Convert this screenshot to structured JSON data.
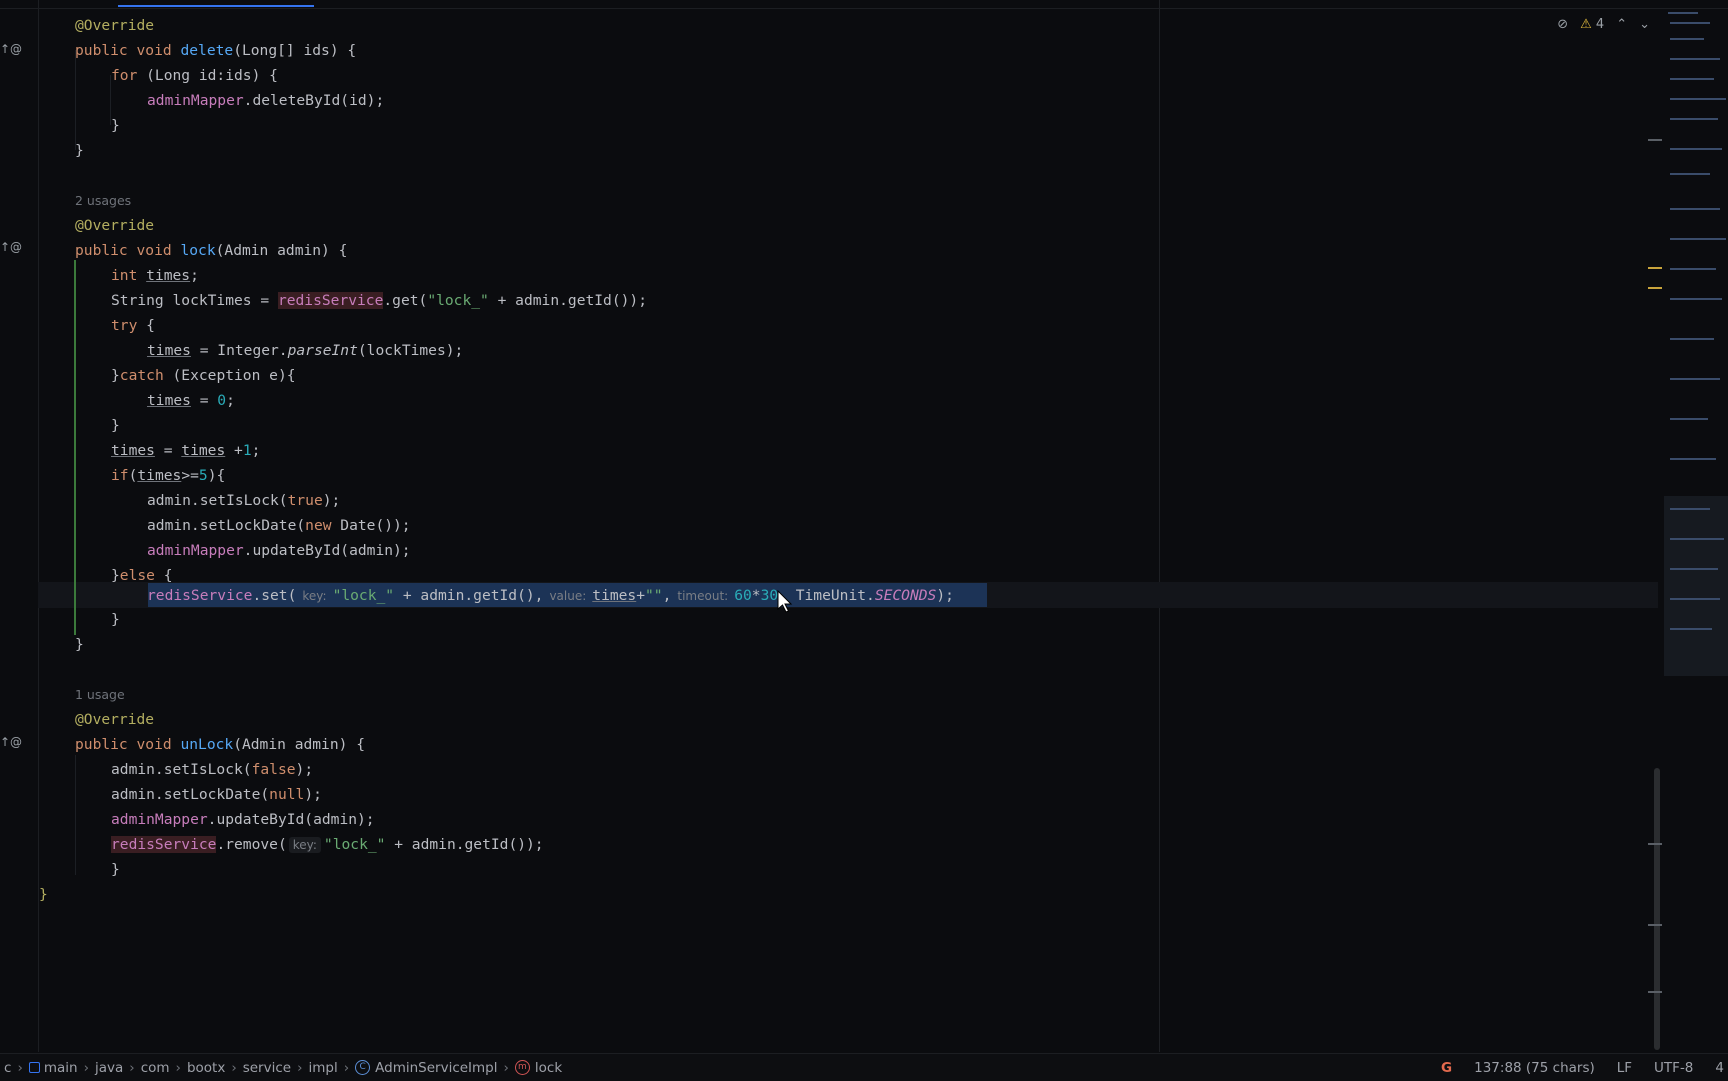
{
  "editor": {
    "usages_delete": "",
    "usages_lock": "2 usages",
    "usages_unlock": "1 usage",
    "annotation": "@Override",
    "keywords": {
      "public": "public",
      "void": "void",
      "for": "for",
      "int": "int",
      "try": "try",
      "catch": "catch",
      "if": "if",
      "else": "else",
      "new": "new"
    },
    "delete_method": {
      "name": "delete",
      "params": "(Long[] ids) {",
      "for_head": " (Long id:ids) {",
      "body": "adminMapper",
      "body_rest": ".deleteById(id);"
    },
    "lock_method": {
      "name": "lock",
      "params": "(Admin admin) {",
      "l1_var": "times",
      "l2_pre": "String lockTimes = ",
      "l2_field": "redisService",
      "l2_call": ".get(",
      "l2_str": "\"lock_\"",
      "l2_rest": " + admin.getId());",
      "l4_var": "times",
      "l4_mid": " = Integer.",
      "l4_fn": "parseInt",
      "l4_rest": "(lockTimes);",
      "l5_rest": " (Exception e){",
      "l6_var": "times",
      "l6_mid": " = ",
      "l6_num": "0",
      "l8_a": "times",
      "l8_mid": " = ",
      "l8_b": "times",
      "l8_op": " +",
      "l8_num": "1",
      "l9_paren": "(",
      "l9_var": "times",
      "l9_op": ">=",
      "l9_num": "5",
      "l9_end": "){",
      "l10_pre": "admin.setIsLock(",
      "l10_val": "true",
      "l10_end": ");",
      "l11_pre": "admin.setLockDate(",
      "l11_cls": " Date());",
      "l12_field": "adminMapper",
      "l12_rest": ".updateById(admin);",
      "l14_field": "redisService",
      "l14_call": ".set(",
      "l14_hint_key": "key:",
      "l14_str": "\"lock_\"",
      "l14_mid": " + admin.getId(),",
      "l14_hint_value": "value:",
      "l14_var": "times",
      "l14_plus": "+",
      "l14_str2": "\"\"",
      "l14_comma": ",",
      "l14_hint_timeout": "timeout:",
      "l14_num1": "60",
      "l14_star": "*",
      "l14_num2": "30",
      "l14_unit": ", TimeUnit.",
      "l14_const": "SECONDS",
      "l14_end": ");"
    },
    "unlock_method": {
      "name": "unLock",
      "params": "(Admin admin) {",
      "l1_pre": "admin.setIsLock(",
      "l1_val": "false",
      "l1_end": ");",
      "l2_pre": "admin.setLockDate(",
      "l2_val": "null",
      "l2_end": ");",
      "l3_field": "adminMapper",
      "l3_rest": ".updateById(admin);",
      "l4_field": "redisService",
      "l4_call": ".remove(",
      "l4_hint_key": "key:",
      "l4_str": "\"lock_\"",
      "l4_rest": " + admin.getId());"
    },
    "brace_open": "{",
    "brace_close": "}",
    "int_semi": ";"
  },
  "inspections": {
    "warning_count": "4"
  },
  "statusbar": {
    "breadcrumbs": [
      "c",
      "main",
      "java",
      "com",
      "bootx",
      "service",
      "impl",
      "AdminServiceImpl",
      "lock"
    ],
    "position": "137:88 (75 chars)",
    "line_separator": "LF",
    "encoding": "UTF-8",
    "indent": "4"
  },
  "icons": [
    "gutter-override-icon",
    "bulb-icon",
    "warning-icon",
    "eye-off-icon",
    "chevron-up-icon",
    "chevron-down-icon",
    "class-icon",
    "method-icon",
    "module-icon",
    "google-icon"
  ],
  "colors": {
    "keyword": "#cf8e6d",
    "function": "#56a8f5",
    "string": "#6aab73",
    "number": "#2aacb8",
    "field": "#c77dbb",
    "annotation": "#b3ae60",
    "selection": "#1c3356"
  }
}
